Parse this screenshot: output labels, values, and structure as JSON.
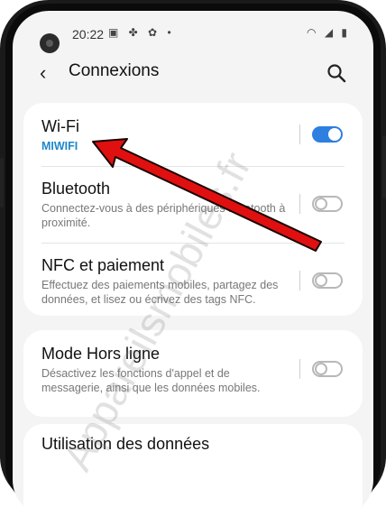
{
  "status_bar": {
    "time": "20:22",
    "left_icons": "▣ ✤ ✿ •",
    "right_icons": "◠ ◢ ▮"
  },
  "app_bar": {
    "title": "Connexions"
  },
  "items": {
    "wifi": {
      "title": "Wi-Fi",
      "subtitle": "MIWIFI",
      "toggle": "on"
    },
    "bluetooth": {
      "title": "Bluetooth",
      "subtitle": "Connectez-vous à des périphériques Bluetooth à proximité.",
      "toggle": "off"
    },
    "nfc": {
      "title": "NFC et paiement",
      "subtitle": "Effectuez des paiements mobiles, partagez des données, et lisez ou écrivez des tags NFC.",
      "toggle": "off"
    },
    "airplane": {
      "title": "Mode Hors ligne",
      "subtitle": "Désactivez les fonctions d'appel et de messagerie, ainsi que les données mobiles.",
      "toggle": "off"
    },
    "data_usage": {
      "title": "Utilisation des données"
    }
  },
  "watermark": "Appareilsmobiles.fr",
  "colors": {
    "accent": "#1e88c8",
    "toggle_on": "#2d7fe0",
    "arrow": "#e01010"
  }
}
